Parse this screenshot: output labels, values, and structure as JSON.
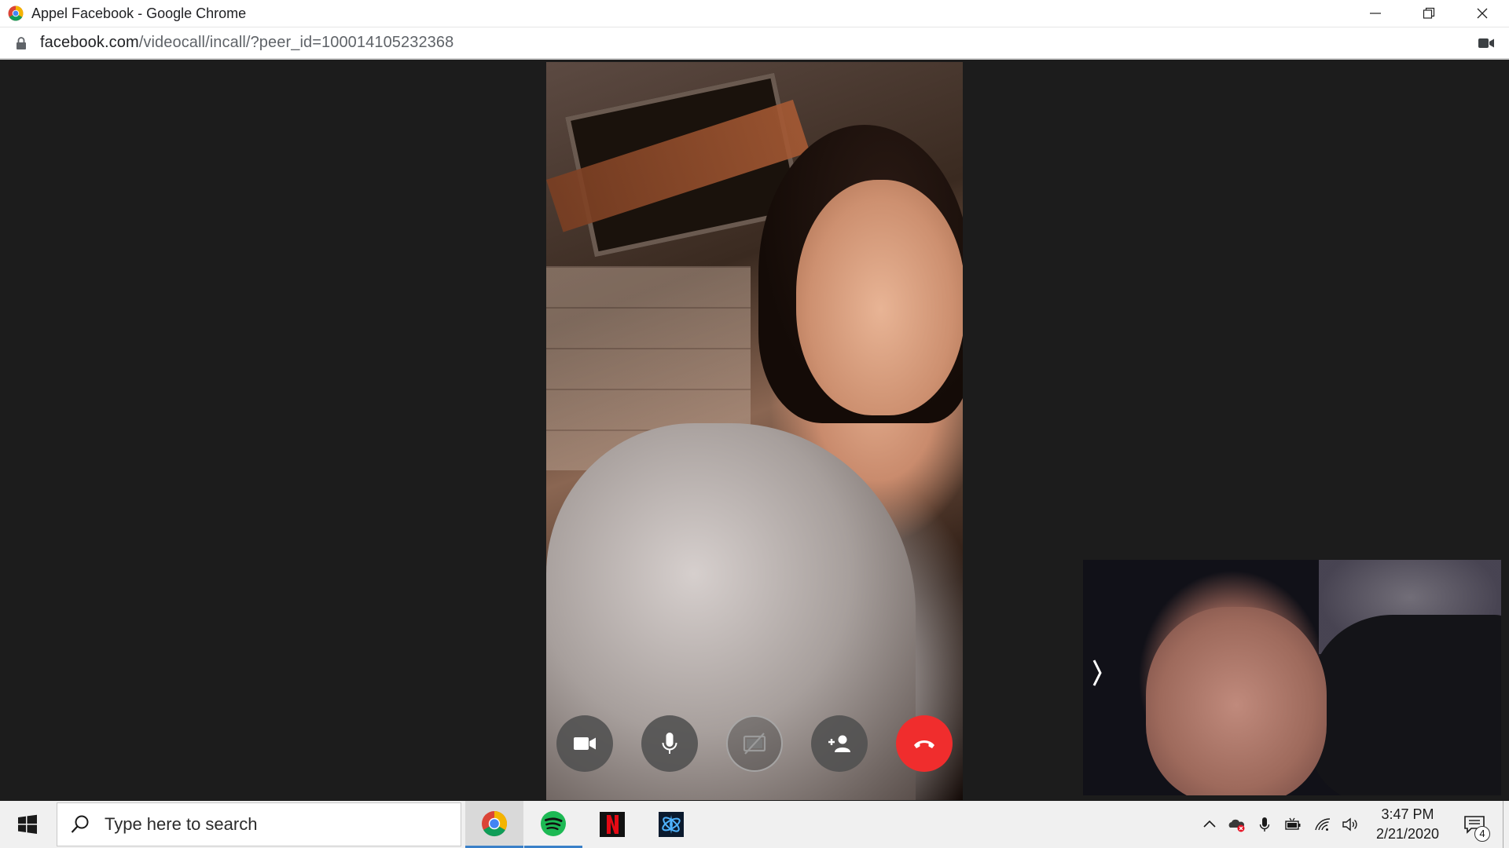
{
  "window": {
    "title": "Appel Facebook - Google Chrome",
    "icon": "chrome-icon",
    "controls": [
      "minimize-icon",
      "restore-icon",
      "close-icon"
    ]
  },
  "addressbar": {
    "url_host": "facebook.com",
    "url_path": "/videocall/incall/?peer_id=100014105232368",
    "icons": [
      "lock-icon",
      "camera-in-use-icon"
    ]
  },
  "call": {
    "controls": [
      {
        "name": "toggle-video-button",
        "icon": "video-camera-icon",
        "style": "grey"
      },
      {
        "name": "toggle-mic-button",
        "icon": "microphone-icon",
        "style": "grey"
      },
      {
        "name": "share-screen-button",
        "icon": "screen-share-off-icon",
        "style": "outline"
      },
      {
        "name": "add-person-button",
        "icon": "add-person-icon",
        "style": "grey"
      },
      {
        "name": "end-call-button",
        "icon": "hang-up-icon",
        "style": "red",
        "color": "#f02d2d"
      }
    ],
    "self_view_toggle": "chevron-right-icon"
  },
  "taskbar": {
    "search_placeholder": "Type here to search",
    "apps": [
      {
        "name": "chrome",
        "icon": "chrome-icon",
        "state": "active"
      },
      {
        "name": "spotify",
        "icon": "spotify-icon",
        "state": "running"
      },
      {
        "name": "netflix",
        "icon": "netflix-icon",
        "state": "pinned"
      },
      {
        "name": "battle-net",
        "icon": "battlenet-icon",
        "state": "pinned"
      }
    ],
    "tray_icons": [
      "chevron-up-icon",
      "onedrive-error-icon",
      "microphone-icon",
      "battery-icon",
      "wifi-icon",
      "volume-icon"
    ],
    "time": "3:47 PM",
    "date": "2/21/2020",
    "notification_count": "4"
  },
  "colors": {
    "background": "#1c1c1c",
    "end_call": "#f02d2d",
    "taskbar_accent": "#3a80c8"
  }
}
